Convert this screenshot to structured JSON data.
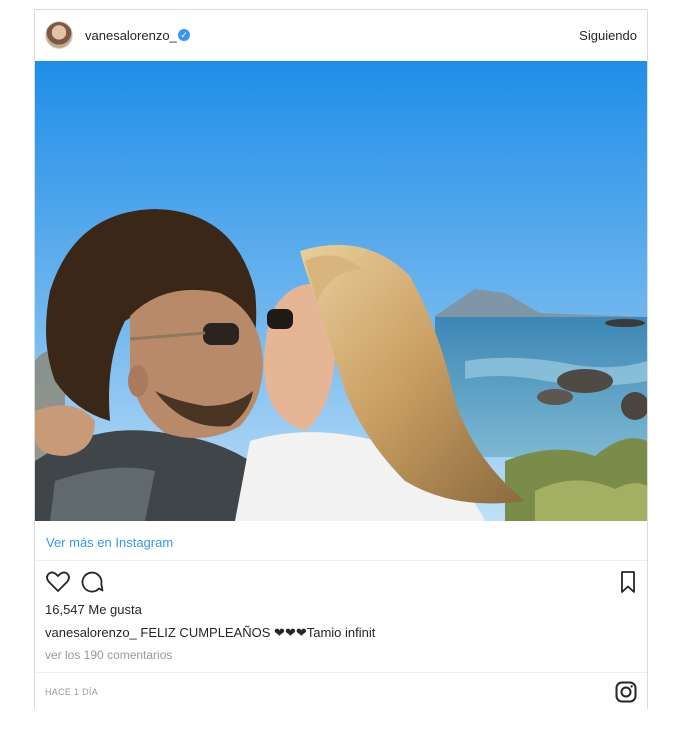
{
  "post": {
    "username": "vanesalorenzo_",
    "verified_glyph": "✓",
    "follow_state": "Siguiendo",
    "view_more_link": "Ver más en Instagram",
    "likes": "16,547 Me gusta",
    "caption_user": "vanesalorenzo_",
    "caption_text": "FELIZ CUMPLEAÑOS ❤❤❤Tamio infinit",
    "comments_link": "ver los 190 comentarios",
    "timestamp": "HACE 1 DÍA"
  },
  "icons": {
    "avatar": "profile-avatar",
    "like": "heart-icon",
    "comment": "comment-icon",
    "save": "bookmark-icon",
    "brand": "instagram-icon"
  },
  "colors": {
    "link": "#3897f0",
    "muted": "#999999",
    "text": "#262626",
    "border": "#dbdbdb"
  }
}
